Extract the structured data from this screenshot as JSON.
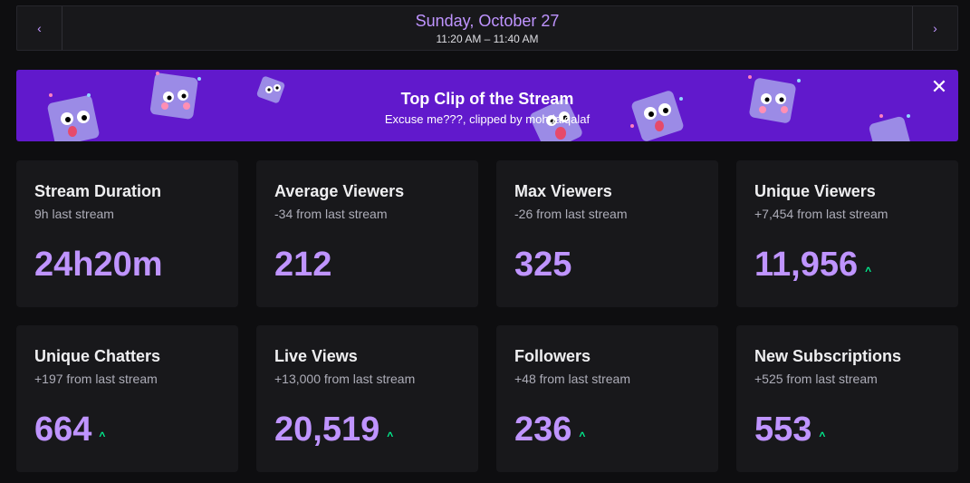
{
  "header": {
    "date": "Sunday, October 27",
    "time_range": "11:20 AM – 11:40 AM",
    "prev_icon": "chevron-left-icon",
    "next_icon": "chevron-right-icon"
  },
  "banner": {
    "title": "Top Clip of the Stream",
    "subtitle": "Excuse me???, clipped by mohdalqalaf",
    "close_label": "✕",
    "background": "#6119cc"
  },
  "stats": [
    {
      "title": "Stream Duration",
      "sub": "9h last stream",
      "value": "24h20m",
      "trend": ""
    },
    {
      "title": "Average Viewers",
      "sub": "-34 from last stream",
      "value": "212",
      "trend": ""
    },
    {
      "title": "Max Viewers",
      "sub": "-26 from last stream",
      "value": "325",
      "trend": ""
    },
    {
      "title": "Unique Viewers",
      "sub": "+7,454 from last stream",
      "value": "11,956",
      "trend": "up"
    },
    {
      "title": "Unique Chatters",
      "sub": "+197 from last stream",
      "value": "664",
      "trend": "up"
    },
    {
      "title": "Live Views",
      "sub": "+13,000 from last stream",
      "value": "20,519",
      "trend": "up"
    },
    {
      "title": "Followers",
      "sub": "+48 from last stream",
      "value": "236",
      "trend": "up"
    },
    {
      "title": "New Subscriptions",
      "sub": "+525 from last stream",
      "value": "553",
      "trend": "up"
    }
  ],
  "colors": {
    "accent": "#bf94ff",
    "up": "#00f593",
    "card": "#18181b",
    "page": "#0e0e10"
  }
}
